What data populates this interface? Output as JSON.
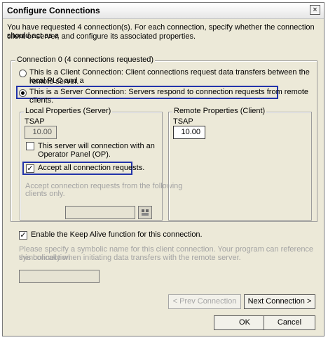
{
  "title": "Configure Connections",
  "intro": [
    "You have requested 4 connection(s). For each connection, specify whether the connection should act as a",
    "client or server, and configure its associated properties."
  ],
  "connection_group": {
    "legend": "Connection 0 (4 connections requested)",
    "client_option": [
      "This is a Client Connection: Client connections request data transfers between the local PLC and a",
      "remote server."
    ],
    "server_option": "This is a Server Connection: Servers respond to connection requests from remote clients.",
    "selected": "server"
  },
  "local": {
    "legend": "Local Properties (Server)",
    "tsap_label": "TSAP",
    "tsap_value": "10.00",
    "op_check": [
      "This server will connection with an",
      "Operator Panel (OP)."
    ],
    "op_checked": false,
    "accept_all": "Accept all connection requests.",
    "accept_all_checked": true,
    "accept_from": [
      "Accept connection requests from the following",
      "clients only."
    ]
  },
  "remote": {
    "legend": "Remote Properties (Client)",
    "tsap_label": "TSAP",
    "tsap_value": "10.00"
  },
  "keepalive": {
    "label": "Enable the Keep Alive function for this connection.",
    "checked": true
  },
  "symbolic_hint": [
    "Please specify a symbolic name for this client connection.  Your program can reference this connection",
    "symbolically when initiating data transfers with the remote server."
  ],
  "buttons": {
    "prev": "< Prev Connection",
    "next": "Next Connection >",
    "ok": "OK",
    "cancel": "Cancel",
    "close": "×"
  },
  "icons": {
    "close": "close-icon",
    "address_lookup": "address-book-icon"
  }
}
